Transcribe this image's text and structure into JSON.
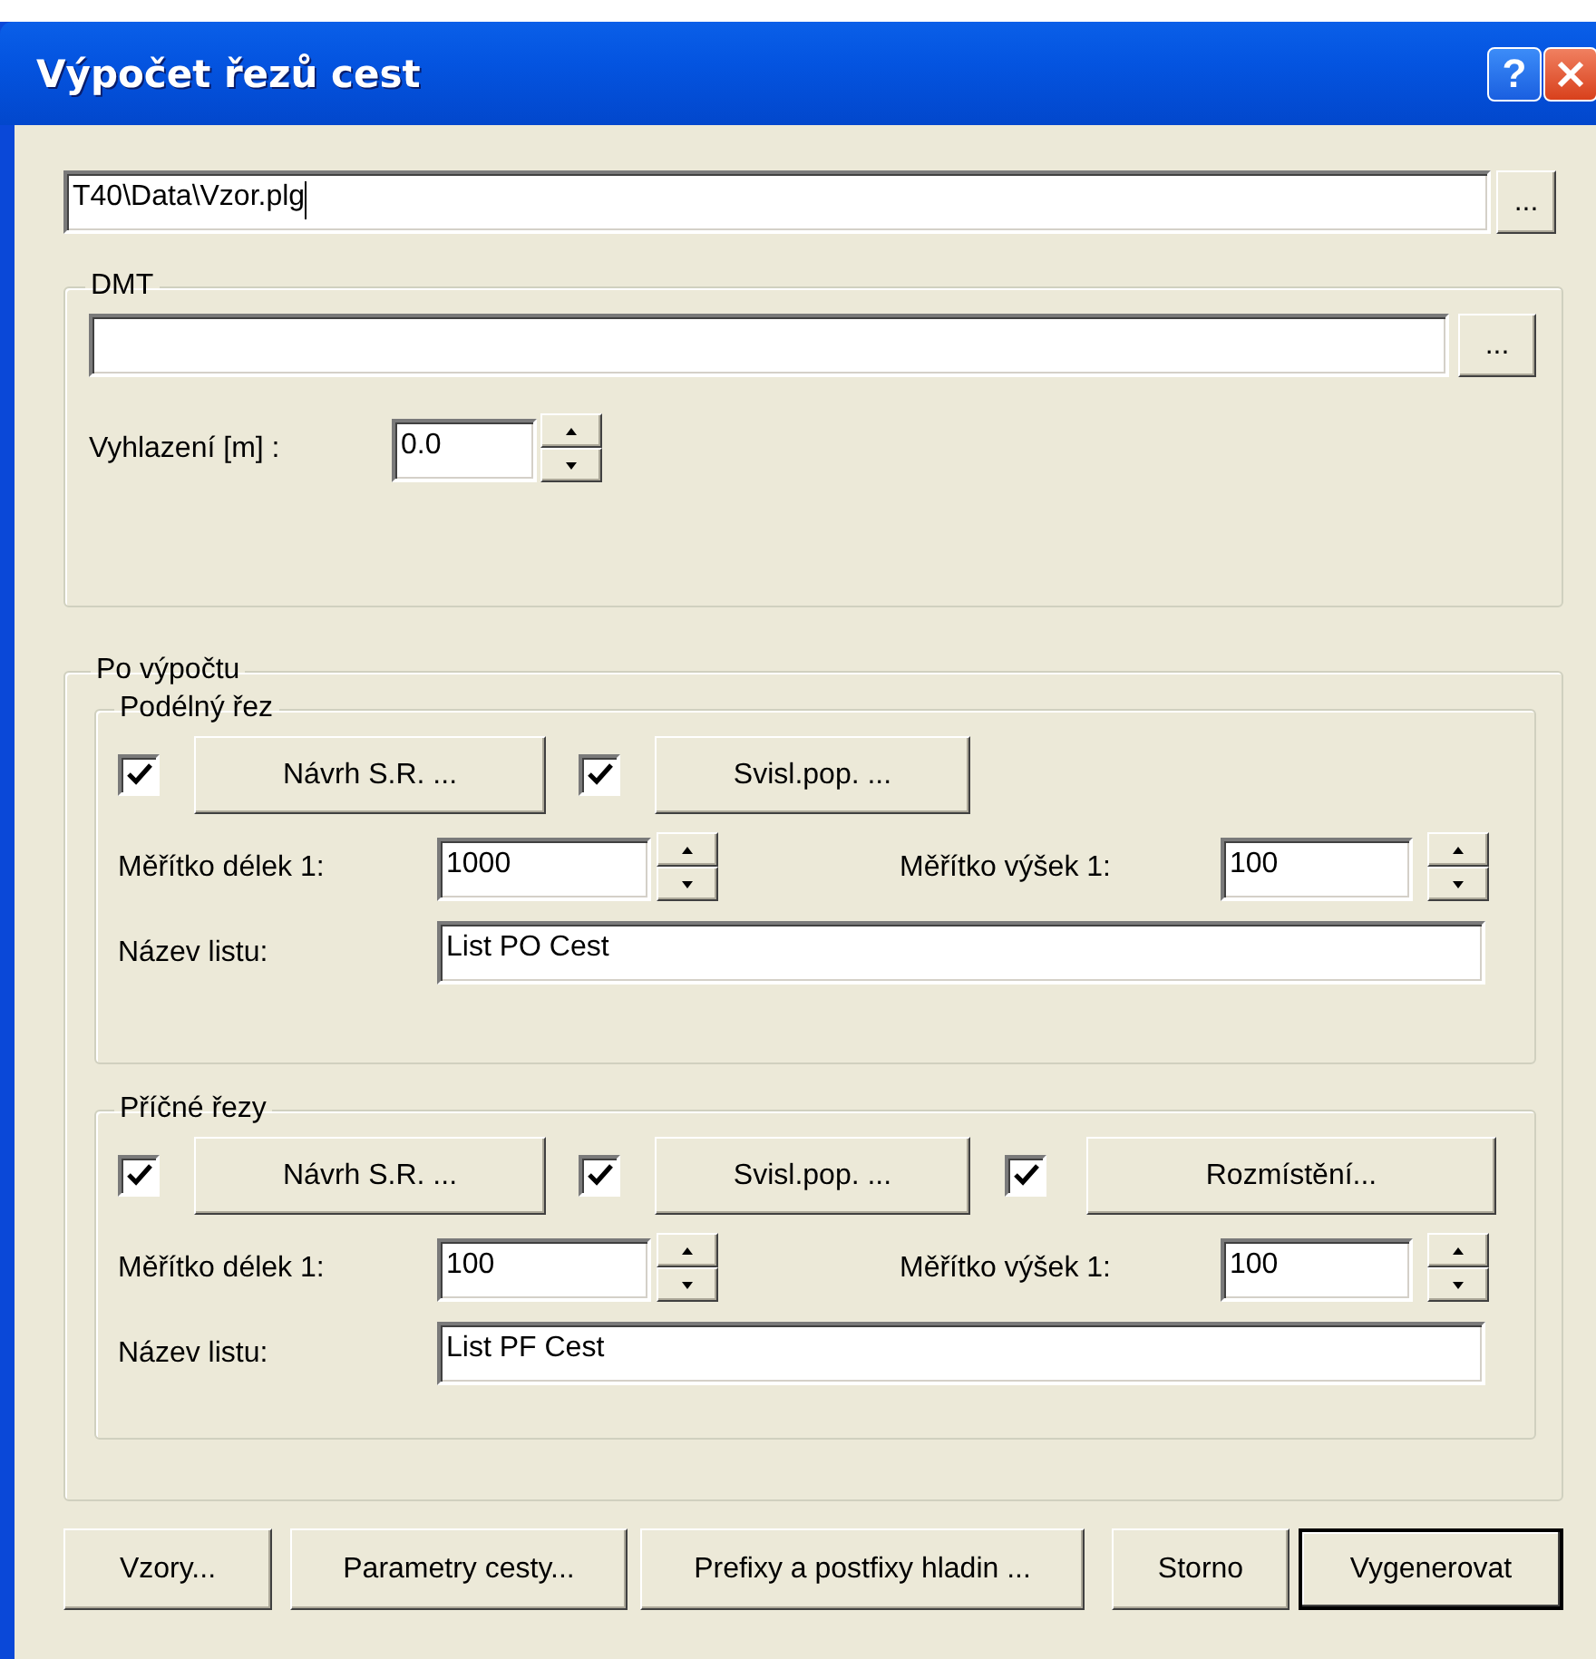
{
  "window": {
    "title": "Výpočet řezů cest",
    "help_button": "?"
  },
  "file": {
    "value": "T40\\Data\\Vzor.plg",
    "focused": true,
    "browse_button": "..."
  },
  "dmt": {
    "legend": "DMT",
    "browse_button": "...",
    "smoothing": {
      "label": "Vyhlazení [m] :",
      "value": "0.0"
    }
  },
  "after_calc": {
    "legend": "Po výpočtu",
    "sections": [
      {
        "legend": "Podélný řez",
        "options": [
          {
            "checked": true,
            "button": "Návrh S.R. ..."
          },
          {
            "checked": true,
            "button": "Svisl.pop. ..."
          }
        ],
        "length_scale": {
          "label": "Měřítko délek 1:",
          "value": "1000"
        },
        "height_scale": {
          "label": "Měřítko výšek 1:",
          "value": "100"
        },
        "sheet_name": {
          "label": "Název listu:",
          "value": "List PO Cest"
        }
      },
      {
        "legend": "Příčné řezy",
        "options": [
          {
            "checked": true,
            "button": "Návrh S.R. ..."
          },
          {
            "checked": true,
            "button": "Svisl.pop. ..."
          },
          {
            "checked": true,
            "button": "Rozmístění..."
          }
        ],
        "length_scale": {
          "label": "Měřítko délek 1:",
          "value": "100"
        },
        "height_scale": {
          "label": "Měřítko výšek 1:",
          "value": "100"
        },
        "sheet_name": {
          "label": "Název listu:",
          "value": "List PF Cest"
        }
      }
    ]
  },
  "buttons": [
    {
      "label": "Vzory...",
      "default": false
    },
    {
      "label": "Parametry cesty...",
      "default": false
    },
    {
      "label": "Prefixy a postfixy hladin ...",
      "default": false
    },
    {
      "label": "Storno",
      "default": false
    },
    {
      "label": "Vygenerovat",
      "default": true
    }
  ]
}
